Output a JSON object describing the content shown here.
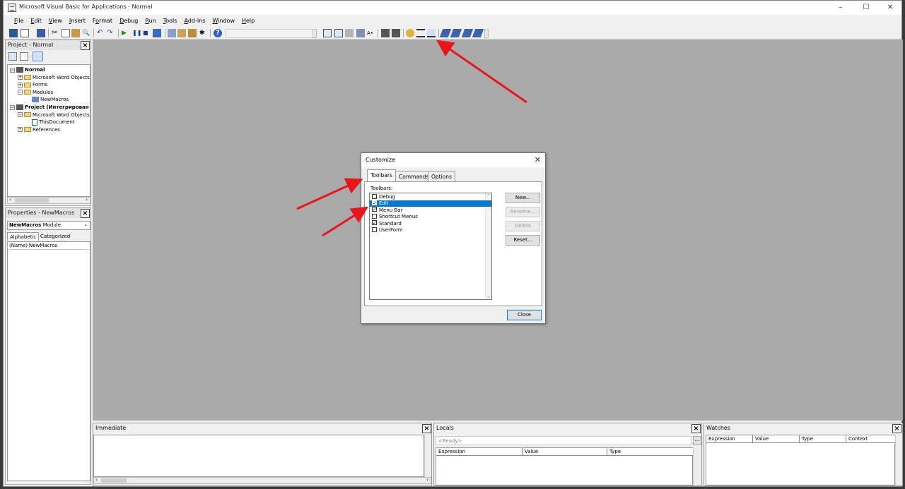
{
  "window": {
    "title": "Microsoft Visual Basic for Applications - Normal",
    "controls": [
      "–",
      "☐",
      "✕"
    ]
  },
  "menu": [
    {
      "label": "File",
      "ul": "F"
    },
    {
      "label": "Edit",
      "ul": "E"
    },
    {
      "label": "View",
      "ul": "V"
    },
    {
      "label": "Insert",
      "ul": "I"
    },
    {
      "label": "Format",
      "ul": "o"
    },
    {
      "label": "Debug",
      "ul": "D"
    },
    {
      "label": "Run",
      "ul": "R"
    },
    {
      "label": "Tools",
      "ul": "T"
    },
    {
      "label": "Add-Ins",
      "ul": "A"
    },
    {
      "label": "Window",
      "ul": "W"
    },
    {
      "label": "Help",
      "ul": "H"
    }
  ],
  "project_pane": {
    "title": "Project - Normal",
    "tree": [
      {
        "label": "Normal",
        "level": 0,
        "bold": true,
        "icon": "project",
        "expander": "−"
      },
      {
        "label": "Microsoft Word Objects",
        "level": 1,
        "icon": "folder",
        "expander": "+"
      },
      {
        "label": "Forms",
        "level": 1,
        "icon": "folder",
        "expander": "+"
      },
      {
        "label": "Modules",
        "level": 1,
        "icon": "folder",
        "expander": "−"
      },
      {
        "label": "NewMacros",
        "level": 2,
        "icon": "module",
        "expander": ""
      },
      {
        "label": "Project (Интегрирован",
        "level": 0,
        "bold": true,
        "icon": "project",
        "expander": "−"
      },
      {
        "label": "Microsoft Word Objects",
        "level": 1,
        "icon": "folder",
        "expander": "−"
      },
      {
        "label": "ThisDocument",
        "level": 2,
        "icon": "document",
        "expander": ""
      },
      {
        "label": "References",
        "level": 1,
        "icon": "folder",
        "expander": "+"
      }
    ]
  },
  "properties_pane": {
    "title": "Properties - NewMacros",
    "object_name": "NewMacros",
    "object_type": "Module",
    "tabs": [
      "Alphabetic",
      "Categorized"
    ],
    "row_name": "(Name)",
    "row_value": "NewMacros"
  },
  "dialog": {
    "title": "Customize",
    "tabs": [
      {
        "label": "Toolbars",
        "active": true
      },
      {
        "label": "Commands",
        "active": false
      },
      {
        "label": "Options",
        "active": false
      }
    ],
    "list_label": "Toolbars:",
    "toolbars": [
      {
        "label": "Debug",
        "checked": false,
        "selected": false
      },
      {
        "label": "Edit",
        "checked": true,
        "selected": true
      },
      {
        "label": "Menu Bar",
        "checked": true,
        "selected": false
      },
      {
        "label": "Shortcut Menus",
        "checked": false,
        "selected": false
      },
      {
        "label": "Standard",
        "checked": true,
        "selected": false
      },
      {
        "label": "UserForm",
        "checked": false,
        "selected": false
      }
    ],
    "buttons": [
      {
        "label": "New...",
        "enabled": true
      },
      {
        "label": "Rename...",
        "enabled": false
      },
      {
        "label": "Delete",
        "enabled": false
      },
      {
        "label": "Reset...",
        "enabled": true
      }
    ],
    "close_label": "Close"
  },
  "immediate": {
    "title": "Immediate"
  },
  "locals": {
    "title": "Locals",
    "status": "<Ready>",
    "more": "...",
    "columns": [
      "Expression",
      "Value",
      "Type"
    ]
  },
  "watches": {
    "title": "Watches",
    "columns": [
      "Expression",
      "Value",
      "Type",
      "Context"
    ]
  },
  "colors": {
    "annotation_arrow": "#e8151b",
    "selection": "#0078d7",
    "mdi_background": "#aaaaaa"
  }
}
